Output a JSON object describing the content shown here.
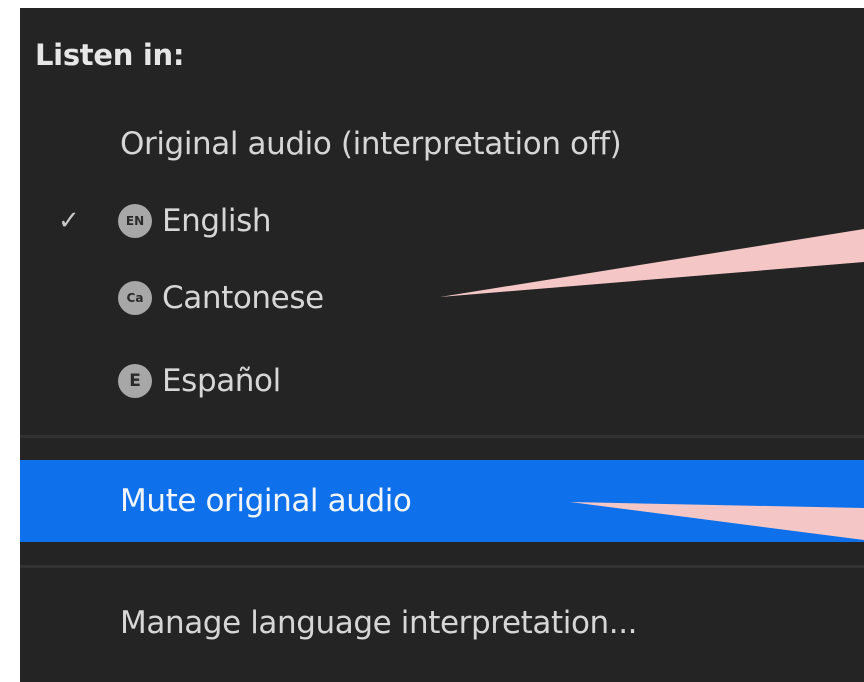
{
  "menu": {
    "header": "Listen in:",
    "items": [
      {
        "label": "Original audio (interpretation off)",
        "checked": false,
        "badge": ""
      },
      {
        "label": "English",
        "checked": true,
        "badge": "EN",
        "check": "✓"
      },
      {
        "label": "Cantonese",
        "checked": false,
        "badge": "Ca"
      },
      {
        "label": "Español",
        "checked": false,
        "badge": "E"
      }
    ],
    "mute_label": "Mute original audio",
    "manage_label": "Manage language interpretation..."
  },
  "colors": {
    "background": "#242424",
    "highlight": "#0e71eb",
    "callout": "#f4c6c6"
  }
}
